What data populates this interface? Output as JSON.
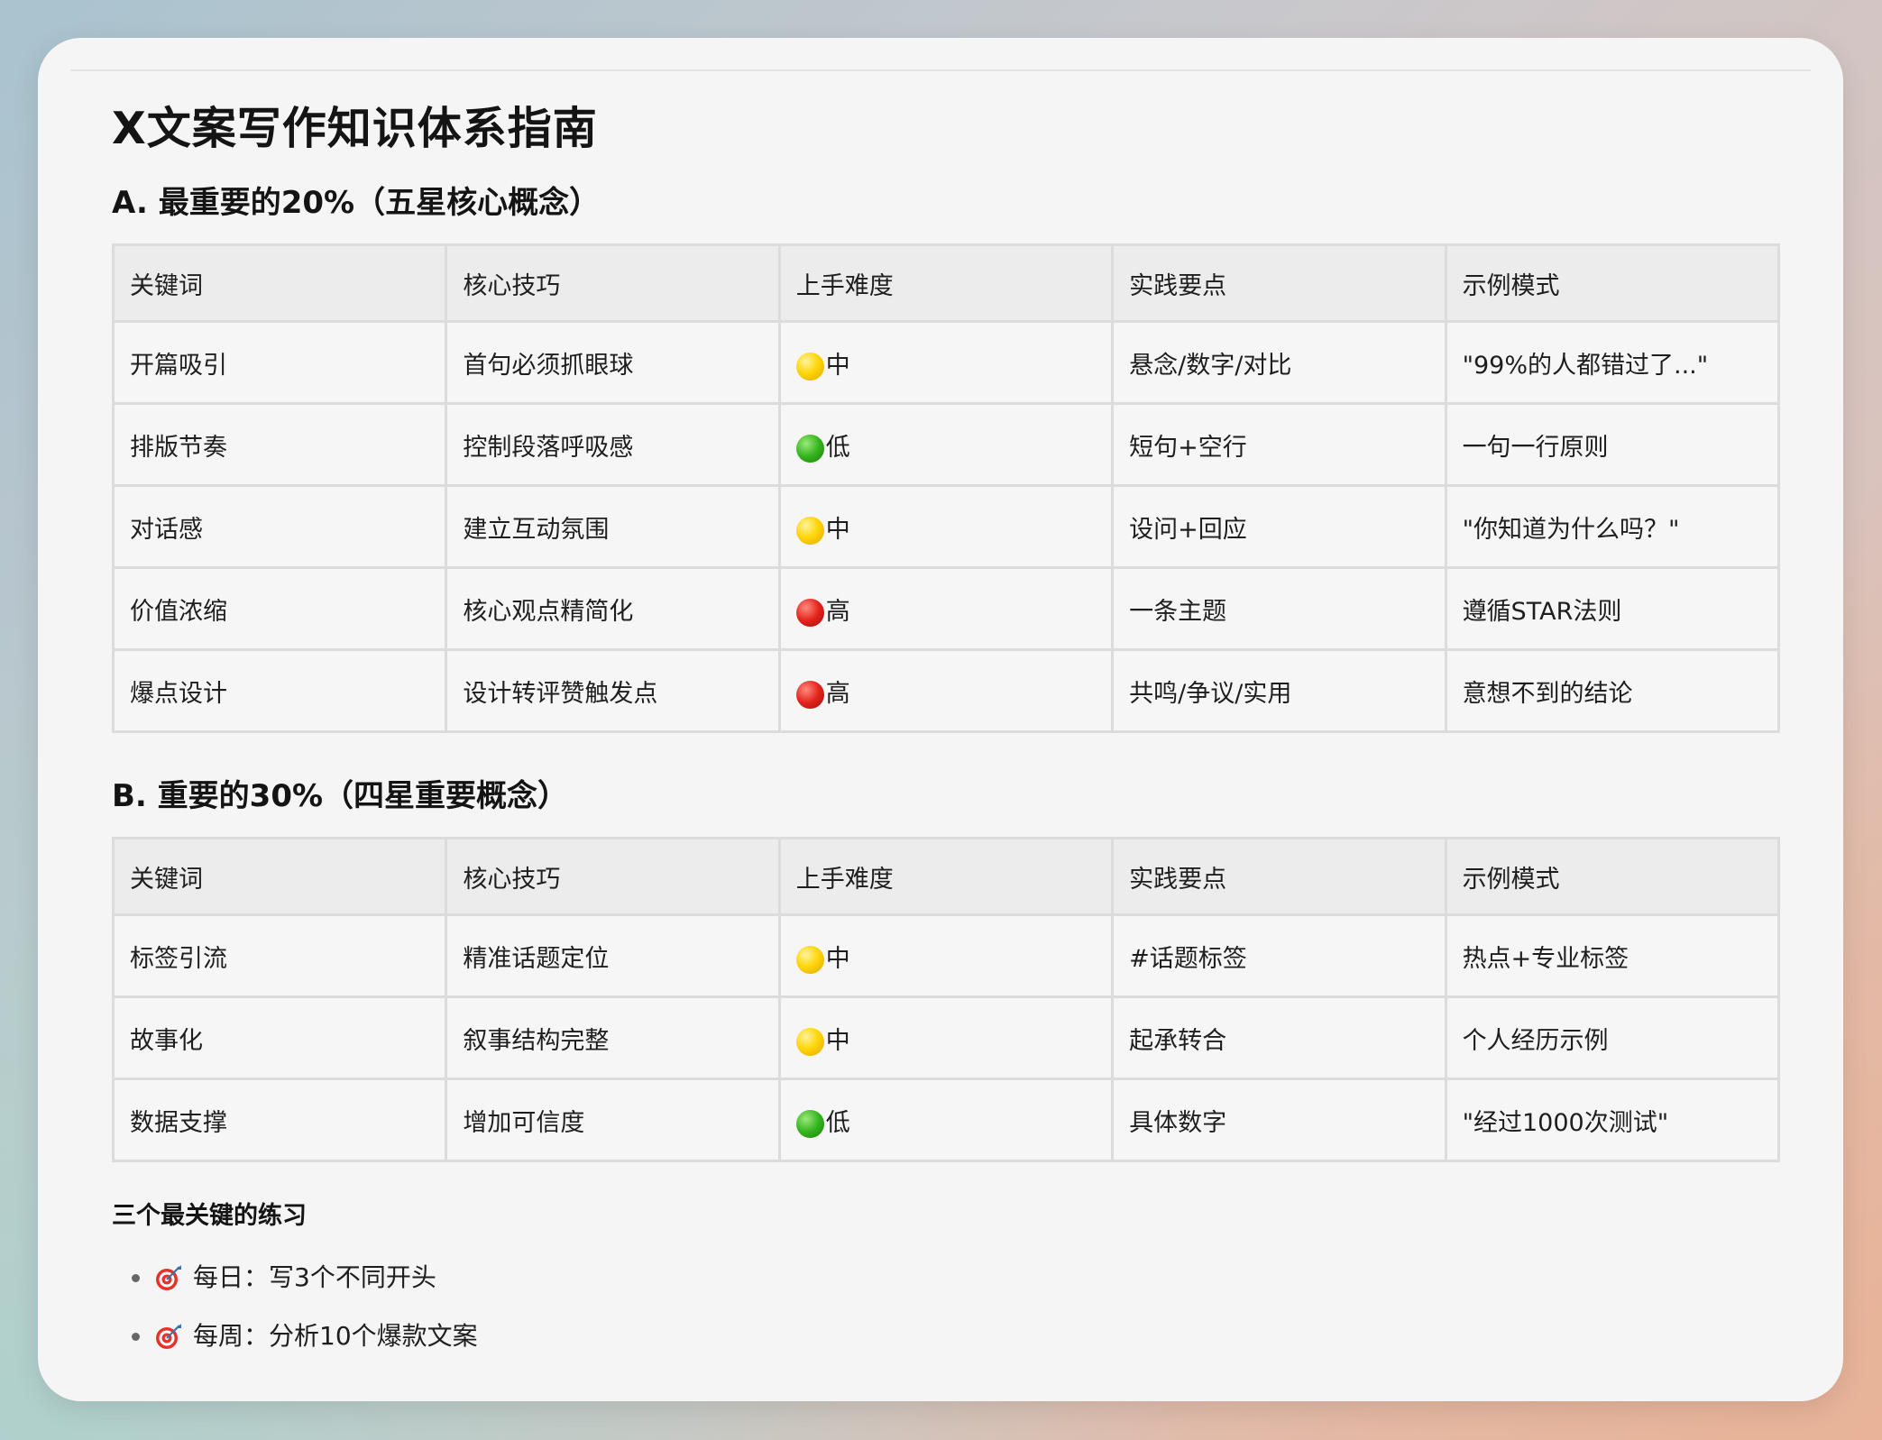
{
  "title": "X文案写作知识体系指南",
  "section_a": {
    "heading": "A. 最重要的20%（五星核心概念）",
    "headers": [
      "关键词",
      "核心技巧",
      "上手难度",
      "实践要点",
      "示例模式"
    ],
    "rows": [
      {
        "keyword": "开篇吸引",
        "technique": "首句必须抓眼球",
        "difficulty": "中",
        "difficulty_color": "yellow",
        "key_point": "悬念/数字/对比",
        "example": "\"99%的人都错过了...\""
      },
      {
        "keyword": "排版节奏",
        "technique": "控制段落呼吸感",
        "difficulty": "低",
        "difficulty_color": "green",
        "key_point": "短句+空行",
        "example": "一句一行原则"
      },
      {
        "keyword": "对话感",
        "technique": "建立互动氛围",
        "difficulty": "中",
        "difficulty_color": "yellow",
        "key_point": "设问+回应",
        "example": "\"你知道为什么吗？\""
      },
      {
        "keyword": "价值浓缩",
        "technique": "核心观点精简化",
        "difficulty": "高",
        "difficulty_color": "red",
        "key_point": "一条主题",
        "example": "遵循STAR法则"
      },
      {
        "keyword": "爆点设计",
        "technique": "设计转评赞触发点",
        "difficulty": "高",
        "difficulty_color": "red",
        "key_point": "共鸣/争议/实用",
        "example": "意想不到的结论"
      }
    ]
  },
  "section_b": {
    "heading": "B. 重要的30%（四星重要概念）",
    "headers": [
      "关键词",
      "核心技巧",
      "上手难度",
      "实践要点",
      "示例模式"
    ],
    "rows": [
      {
        "keyword": "标签引流",
        "technique": "精准话题定位",
        "difficulty": "中",
        "difficulty_color": "yellow",
        "key_point": "#话题标签",
        "example": "热点+专业标签"
      },
      {
        "keyword": "故事化",
        "technique": "叙事结构完整",
        "difficulty": "中",
        "difficulty_color": "yellow",
        "key_point": "起承转合",
        "example": "个人经历示例"
      },
      {
        "keyword": "数据支撑",
        "technique": "增加可信度",
        "difficulty": "低",
        "difficulty_color": "green",
        "key_point": "具体数字",
        "example": "\"经过1000次测试\""
      }
    ]
  },
  "practice": {
    "title": "三个最关键的练习",
    "items": [
      {
        "icon": "target-icon",
        "text": "每日：写3个不同开头"
      },
      {
        "icon": "target-icon",
        "text": "每周：分析10个爆款文案"
      }
    ]
  },
  "colors": {
    "yellow": "#ffd60a",
    "green": "#34b41d",
    "red": "#e2231a"
  }
}
